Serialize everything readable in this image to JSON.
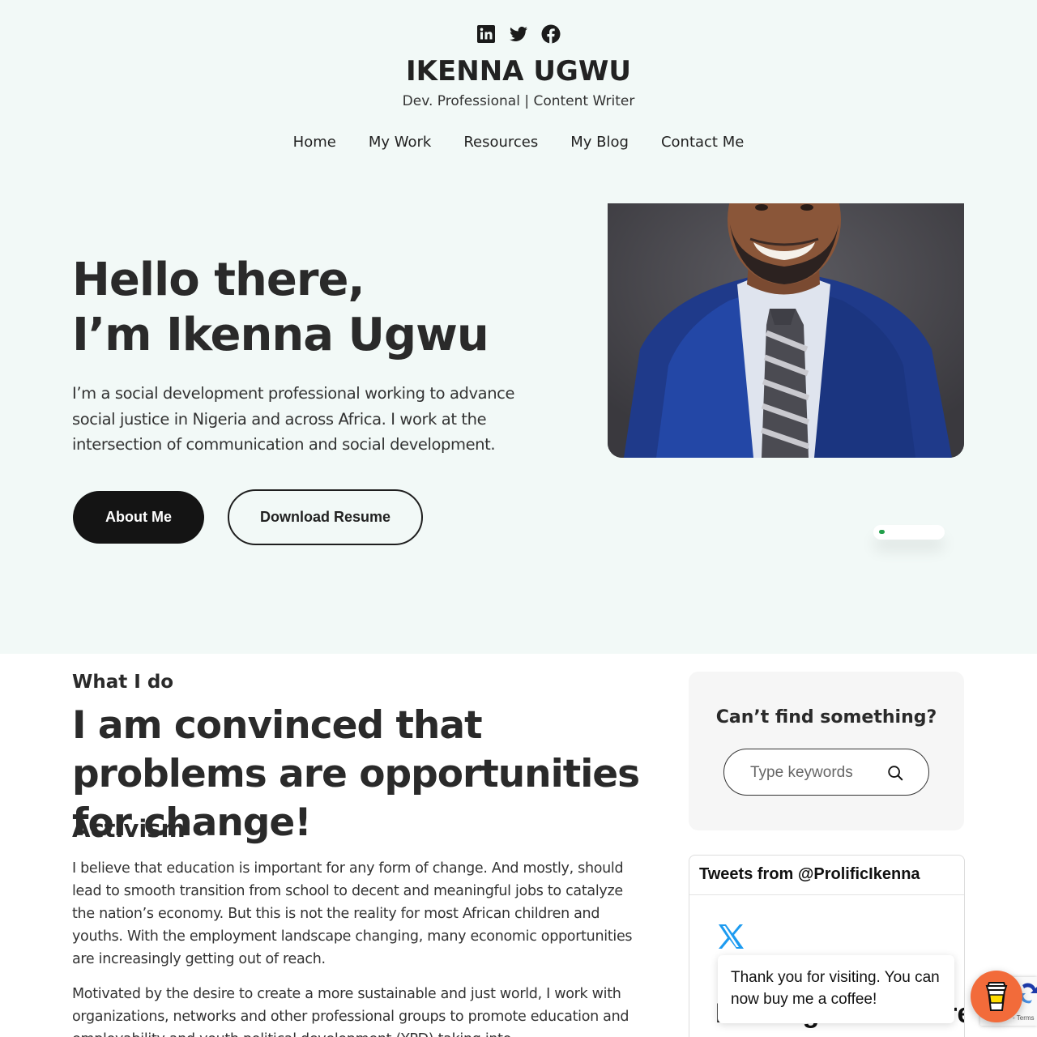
{
  "header": {
    "social": [
      {
        "icon": "linkedin-icon"
      },
      {
        "icon": "twitter-icon"
      },
      {
        "icon": "facebook-icon"
      }
    ],
    "site_title": "IKENNA UGWU",
    "tagline": "Dev. Professional | Content Writer",
    "nav": [
      "Home",
      "My Work",
      "Resources",
      "My Blog",
      "Contact Me"
    ]
  },
  "hero": {
    "heading_line1": "Hello there,",
    "heading_line2": "I’m Ikenna Ugwu",
    "text": "I’m a social development professional working to advance social justice in Nigeria and across Africa. I work at the intersection of communication and social development.",
    "primary_button": "About Me",
    "secondary_button": "Download Resume",
    "status_color": "#22a04b"
  },
  "what_i_do": {
    "eyebrow": "What I do",
    "heading": "I am convinced that problems are opportunities for change!",
    "subheading": "Activism",
    "paragraph1": "I believe that education is important for any form of change. And mostly, should lead to smooth transition from school to decent and meaningful jobs to catalyze the nation’s economy. But this is not the reality for most African children and youths. With the employment landscape changing, many economic opportunities are increasingly getting out of reach.",
    "paragraph2": "Motivated by the desire to create a more sustainable and just world, I work with organizations, networks and other professional groups to promote education and employability and youth political development (YPD) taking into..."
  },
  "sidebar": {
    "search_title": "Can’t find something?",
    "search_placeholder": "Type keywords",
    "tweets_title": "Tweets from @ProlificIkenna",
    "tweets_loading": "Nothing to see here"
  },
  "coffee": {
    "message": "Thank you for visiting. You can now buy me a coffee!",
    "brand_color": "#f26b3a"
  },
  "recaptcha": {
    "terms": "- Terms"
  }
}
